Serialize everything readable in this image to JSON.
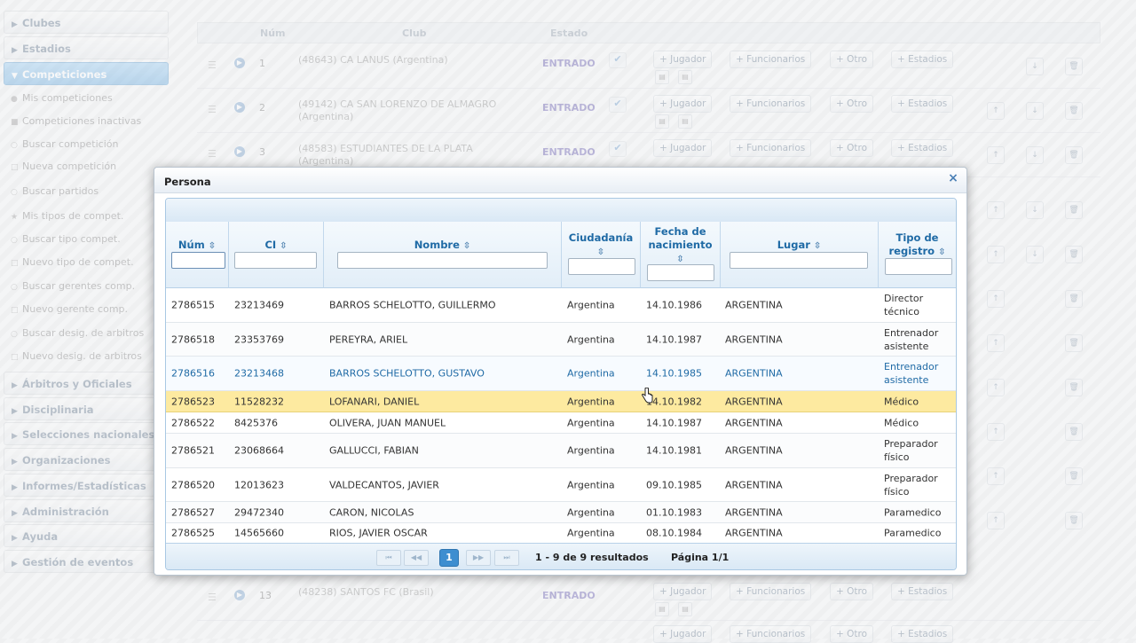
{
  "sidebar": {
    "sections_top": [
      {
        "label": "Clubes",
        "active": false
      },
      {
        "label": "Estadios",
        "active": false
      },
      {
        "label": "Competiciones",
        "active": true
      }
    ],
    "links": [
      "Mis competiciones",
      "Competiciones inactivas",
      "Buscar competición",
      "Nueva competición",
      "Buscar partidos",
      "Mis tipos de compet.",
      "Buscar tipo compet.",
      "Nuevo tipo de compet.",
      "Buscar gerentes comp.",
      "Nuevo gerente comp.",
      "Buscar desig. de arbitros",
      "Nuevo desig. de arbitros"
    ],
    "sections_bottom": [
      "Árbitros y Oficiales",
      "Disciplinaria",
      "Selecciones nacionales",
      "Organizaciones",
      "Informes/Estadísticas",
      "Administración",
      "Ayuda",
      "Gestión de eventos"
    ]
  },
  "background_table": {
    "headers": {
      "num": "Núm",
      "club": "Club",
      "estado": "Estado"
    },
    "actions": {
      "jugador": "+ Jugador",
      "funcionarios": "+ Funcionarios",
      "otro": "+ Otro",
      "estadios": "+ Estadios"
    },
    "rows": [
      {
        "num": "1",
        "club": "(48643) CA LANUS (Argentina)",
        "estado": "ENTRADO"
      },
      {
        "num": "2",
        "club": "(49142) CA SAN LORENZO DE ALMAGRO (Argentina)",
        "estado": "ENTRADO"
      },
      {
        "num": "3",
        "club": "(48583) ESTUDIANTES DE LA PLATA (Argentina)",
        "estado": "ENTRADO"
      },
      {
        "num": "13",
        "club": "(48238) SANTOS FC (Brasil)",
        "estado": "ENTRADO"
      }
    ]
  },
  "modal": {
    "title": "Persona",
    "close_glyph": "×",
    "columns": {
      "num": "Núm",
      "ci": "CI",
      "nombre": "Nombre",
      "ciudadania": "Ciudadanía",
      "fecha_l1": "Fecha de",
      "fecha_l2": "nacimiento",
      "lugar": "Lugar",
      "tipo_l1": "Tipo de",
      "tipo_l2": "registro"
    },
    "sort_glyph": "⇳",
    "rows": [
      {
        "num": "2786515",
        "ci": "23213469",
        "nombre": "BARROS SCHELOTTO, GUILLERMO",
        "ciudadania": "Argentina",
        "fecha": "14.10.1986",
        "lugar": "ARGENTINA",
        "tipo": "Director técnico"
      },
      {
        "num": "2786518",
        "ci": "23353769",
        "nombre": "PEREYRA, ARIEL",
        "ciudadania": "Argentina",
        "fecha": "14.10.1987",
        "lugar": "ARGENTINA",
        "tipo": "Entrenador asistente"
      },
      {
        "num": "2786516",
        "ci": "23213468",
        "nombre": "BARROS SCHELOTTO, GUSTAVO",
        "ciudadania": "Argentina",
        "fecha": "14.10.1985",
        "lugar": "ARGENTINA",
        "tipo": "Entrenador asistente"
      },
      {
        "num": "2786523",
        "ci": "11528232",
        "nombre": "LOFANARI, DANIEL",
        "ciudadania": "Argentina",
        "fecha": "14.10.1982",
        "lugar": "ARGENTINA",
        "tipo": "Médico"
      },
      {
        "num": "2786522",
        "ci": "8425376",
        "nombre": "OLIVERA, JUAN MANUEL",
        "ciudadania": "Argentina",
        "fecha": "14.10.1987",
        "lugar": "ARGENTINA",
        "tipo": "Médico"
      },
      {
        "num": "2786521",
        "ci": "23068664",
        "nombre": "GALLUCCI, FABIAN",
        "ciudadania": "Argentina",
        "fecha": "14.10.1981",
        "lugar": "ARGENTINA",
        "tipo": "Preparador físico"
      },
      {
        "num": "2786520",
        "ci": "12013623",
        "nombre": "VALDECANTOS, JAVIER",
        "ciudadania": "Argentina",
        "fecha": "09.10.1985",
        "lugar": "ARGENTINA",
        "tipo": "Preparador físico"
      },
      {
        "num": "2786527",
        "ci": "29472340",
        "nombre": "CARON, NICOLAS",
        "ciudadania": "Argentina",
        "fecha": "01.10.1983",
        "lugar": "ARGENTINA",
        "tipo": "Paramedico"
      },
      {
        "num": "2786525",
        "ci": "14565660",
        "nombre": "RIOS, JAVIER OSCAR",
        "ciudadania": "Argentina",
        "fecha": "08.10.1984",
        "lugar": "ARGENTINA",
        "tipo": "Paramedico"
      }
    ],
    "pager": {
      "first": "⏮",
      "prev": "◀◀",
      "current": "1",
      "next": "▶▶",
      "last": "⏭",
      "results": "1 - 9 de 9 resultados",
      "page": "Página 1/1"
    }
  },
  "colors": {
    "header_blue": "#1f6aa5",
    "hover_row": "#fdeaa0",
    "selected_text": "#1f6aa5",
    "pager_current": "#3e8ed0"
  }
}
